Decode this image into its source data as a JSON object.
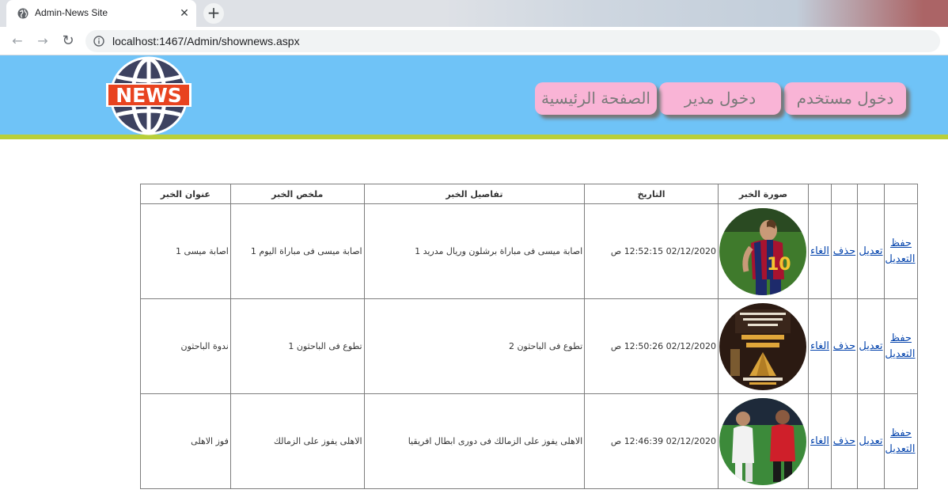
{
  "browser": {
    "tab_title": "Admin-News Site",
    "url": "localhost:1467/Admin/shownews.aspx"
  },
  "header": {
    "logo_text": "NEWS",
    "nav": {
      "user_login": "دخول مستخدم",
      "admin_login": "دخول مدير",
      "home": "الصفحة الرئيسية"
    },
    "colors": {
      "banner": "#6fc3f7",
      "accent_line": "#b9cf3a",
      "button": "#f9b4d6"
    }
  },
  "table": {
    "headers": {
      "title": "عنوان الخبر",
      "summary": "ملخص الخبر",
      "details": "تفاصيل الخبر",
      "date": "التاريخ",
      "image": "صورة الخبر"
    },
    "action_labels": {
      "save": "حفظ التعديل",
      "edit": "تعديل",
      "delete": "حذف",
      "cancel": "الغاء"
    },
    "rows": [
      {
        "title": "اصابة ميسى 1",
        "summary": "اصابة ميسى فى مباراة اليوم 1",
        "details": "اصابة ميسى فى مباراة برشلون وريال مدريد 1",
        "date": "02/12/2020 12:52:15 ص",
        "image": "messi-photo"
      },
      {
        "title": "ندوة الباحثون",
        "summary": "تطوع فى الباحثون 1",
        "details": "تطوع فى الباحثون 2",
        "date": "02/12/2020 12:50:26 ص",
        "image": "researchers-poster"
      },
      {
        "title": "فوز الاهلى",
        "summary": "الاهلى يفوز على الزمالك",
        "details": "الاهلى يفوز على الزمالك فى دورى ابطال افريقيا",
        "date": "02/12/2020 12:46:39 ص",
        "image": "football-match-photo"
      }
    ]
  }
}
